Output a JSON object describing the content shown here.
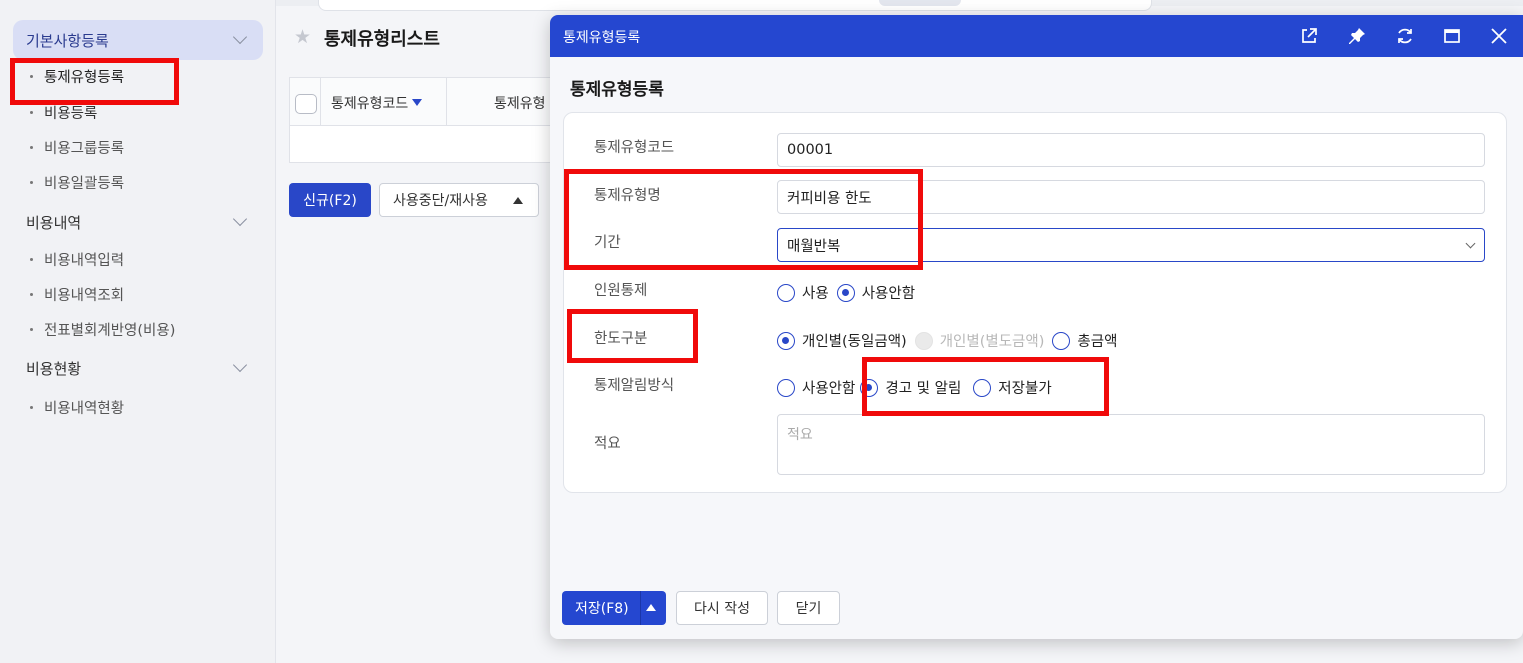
{
  "sidebar": {
    "groups": [
      {
        "label": "기본사항등록",
        "items": [
          "통제유형등록",
          "비용등록",
          "비용그룹등록",
          "비용일괄등록"
        ]
      },
      {
        "label": "비용내역",
        "items": [
          "비용내역입력",
          "비용내역조회",
          "전표별회계반영(비용)"
        ]
      },
      {
        "label": "비용현황",
        "items": [
          "비용내역현황"
        ]
      }
    ]
  },
  "main": {
    "title": "통제유형리스트",
    "columns": [
      "통제유형코드",
      "통제유형"
    ],
    "new_button": "신규(F2)",
    "stop_button": "사용중단/재사용"
  },
  "modal": {
    "window_title": "통제유형등록",
    "heading": "통제유형등록",
    "fields": {
      "code_label": "통제유형코드",
      "code_value": "00001",
      "name_label": "통제유형명",
      "name_value": "커피비용 한도",
      "period_label": "기간",
      "period_value": "매월반복",
      "headcount_label": "인원통제",
      "headcount_options": [
        "사용",
        "사용안함"
      ],
      "headcount_selected": "사용안함",
      "limit_label": "한도구분",
      "limit_options": [
        "개인별(동일금액)",
        "개인별(별도금액)",
        "총금액"
      ],
      "limit_selected": "개인별(동일금액)",
      "notify_label": "통제알림방식",
      "notify_options": [
        "사용안함",
        "경고 및 알림",
        "저장불가"
      ],
      "notify_selected": "경고 및 알림",
      "memo_label": "적요",
      "memo_placeholder": "적요"
    },
    "buttons": {
      "save": "저장(F8)",
      "rewrite": "다시 작성",
      "close": "닫기"
    }
  },
  "colors": {
    "primary": "#2547d0",
    "highlight": "#f00a0a"
  }
}
